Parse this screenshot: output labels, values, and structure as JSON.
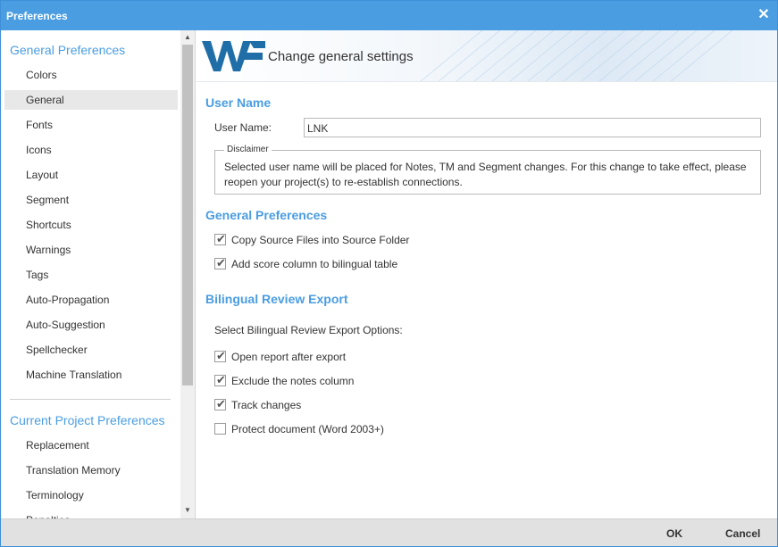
{
  "window": {
    "title": "Preferences",
    "close_icon": "close-icon"
  },
  "sidebar": {
    "general_section_title": "General Preferences",
    "general_items": [
      {
        "label": "Colors"
      },
      {
        "label": "General",
        "active": true
      },
      {
        "label": "Fonts"
      },
      {
        "label": "Icons"
      },
      {
        "label": "Layout"
      },
      {
        "label": "Segment"
      },
      {
        "label": "Shortcuts"
      },
      {
        "label": "Warnings"
      },
      {
        "label": "Tags"
      },
      {
        "label": "Auto-Propagation"
      },
      {
        "label": "Auto-Suggestion"
      },
      {
        "label": "Spellchecker"
      },
      {
        "label": "Machine Translation"
      }
    ],
    "project_section_title": "Current Project Preferences",
    "project_items": [
      {
        "label": "Replacement"
      },
      {
        "label": "Translation Memory"
      },
      {
        "label": "Terminology"
      },
      {
        "label": "Penalties"
      }
    ]
  },
  "banner": {
    "logo": "WF",
    "title": "Change general settings"
  },
  "user_name_section": {
    "heading": "User Name",
    "field_label": "User Name:",
    "field_value": "LNK",
    "disclaimer_legend": "Disclaimer",
    "disclaimer_text": "Selected user name will be placed for Notes, TM and Segment changes. For this change to take effect, please reopen your project(s) to re-establish connections."
  },
  "general_preferences_section": {
    "heading": "General Preferences",
    "options": [
      {
        "label": "Copy Source Files into Source Folder",
        "checked": true
      },
      {
        "label": "Add score column to bilingual table",
        "checked": true
      }
    ]
  },
  "bilingual_export_section": {
    "heading": "Bilingual Review Export",
    "subtitle": "Select Bilingual Review Export Options:",
    "options": [
      {
        "label": "Open report after export",
        "checked": true
      },
      {
        "label": "Exclude the notes column",
        "checked": true
      },
      {
        "label": "Track changes",
        "checked": true
      },
      {
        "label": "Protect document (Word 2003+)",
        "checked": false
      }
    ]
  },
  "footer": {
    "ok_label": "OK",
    "cancel_label": "Cancel"
  },
  "colors": {
    "accent": "#4a9de1",
    "logo": "#1f6ea8"
  }
}
